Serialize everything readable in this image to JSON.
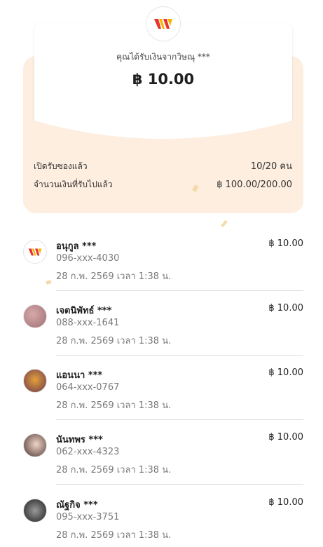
{
  "header": {
    "logo_icon": "brand-w-logo-icon",
    "received_from": "คุณได้รับเงินจากวิษณุ ***",
    "amount": "฿ 10.00"
  },
  "summary": {
    "opened_label": "เปิดรับซองแล้ว",
    "opened_value": "10/20 คน",
    "received_label": "จำนวนเงินที่รับไปแล้ว",
    "received_value": "฿ 100.00/200.00"
  },
  "recipients": [
    {
      "name": "อนุกูล ***",
      "phone": "096-xxx-4030",
      "datetime": "28 ก.พ. 2569 เวลา 1:38 น.",
      "amount": "฿ 10.00",
      "avatar": "brand-logo-avatar"
    },
    {
      "name": "เจตนิพัทธ์ ***",
      "phone": "088-xxx-1641",
      "datetime": "28 ก.พ. 2569 เวลา 1:38 น.",
      "amount": "฿ 10.00",
      "avatar": "photo-avatar"
    },
    {
      "name": "แอนนา ***",
      "phone": "064-xxx-0767",
      "datetime": "28 ก.พ. 2569 เวลา 1:38 น.",
      "amount": "฿ 10.00",
      "avatar": "photo-avatar"
    },
    {
      "name": "นันทพร ***",
      "phone": "062-xxx-4323",
      "datetime": "28 ก.พ. 2569 เวลา 1:38 น.",
      "amount": "฿ 10.00",
      "avatar": "photo-avatar"
    },
    {
      "name": "ณัฐกิจ ***",
      "phone": "095-xxx-3751",
      "datetime": "28 ก.พ. 2569 เวลา 1:38 น.",
      "amount": "฿ 10.00",
      "avatar": "photo-avatar"
    }
  ],
  "colors": {
    "envelope": "#fdeee0",
    "brand_red": "#e8322b",
    "brand_yellow": "#f7b500"
  }
}
